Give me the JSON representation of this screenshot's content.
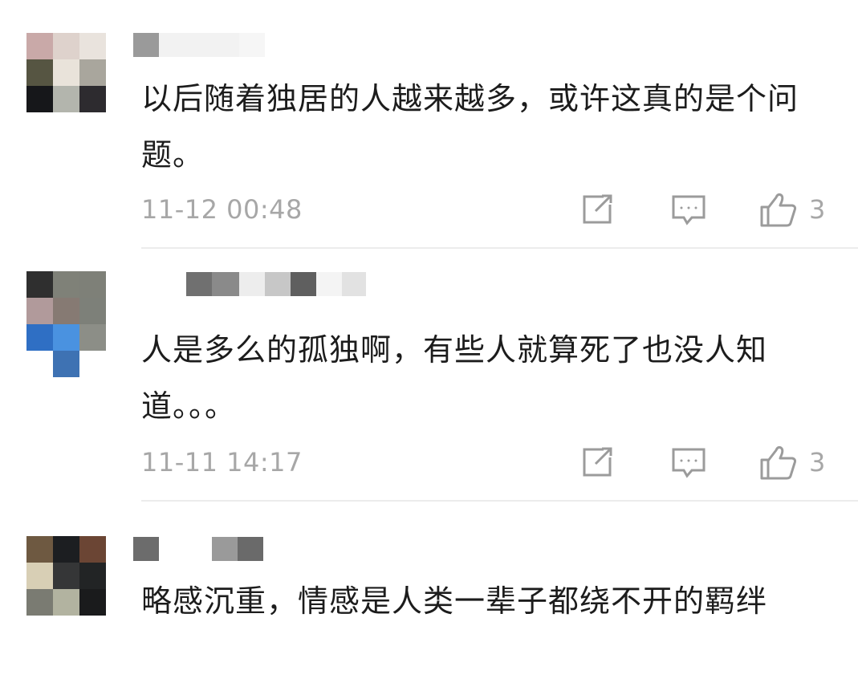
{
  "comments": [
    {
      "text": "以后随着独居的人越来越多，或许这真的是个问题。",
      "timestamp": "11-12 00:48",
      "likes": "3"
    },
    {
      "text": "人是多么的孤独啊，有些人就算死了也没人知道。。。",
      "timestamp": "11-11 14:17",
      "likes": "3"
    },
    {
      "text": "略感沉重，情感是人类一辈子都绕不开的羁绊"
    }
  ],
  "icons": {
    "forward": "share-icon",
    "reply": "comment-icon",
    "like": "thumbs-up-icon"
  },
  "colors": {
    "text": "#1c1c1c",
    "meta": "#a7a7a7",
    "divider": "#ececec"
  }
}
